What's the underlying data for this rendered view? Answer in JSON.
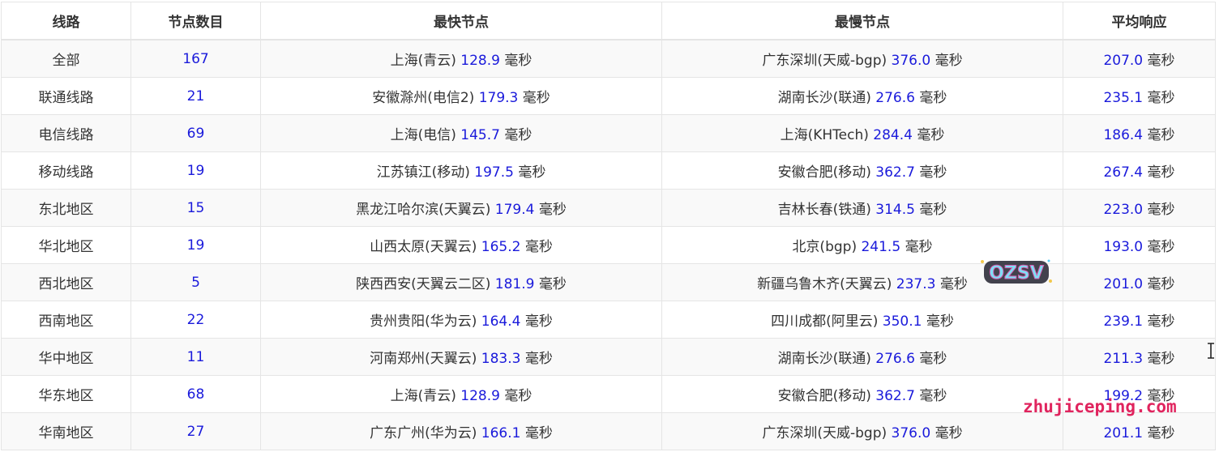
{
  "table": {
    "headers": [
      "线路",
      "节点数目",
      "最快节点",
      "最慢节点",
      "平均响应"
    ],
    "unit": "毫秒",
    "rows": [
      {
        "route": "全部",
        "count": "167",
        "fast_node": "上海(青云)",
        "fast_ms": "128.9",
        "slow_node": "广东深圳(天威-bgp)",
        "slow_ms": "376.0",
        "avg_ms": "207.0"
      },
      {
        "route": "联通线路",
        "count": "21",
        "fast_node": "安徽滁州(电信2)",
        "fast_ms": "179.3",
        "slow_node": "湖南长沙(联通)",
        "slow_ms": "276.6",
        "avg_ms": "235.1"
      },
      {
        "route": "电信线路",
        "count": "69",
        "fast_node": "上海(电信)",
        "fast_ms": "145.7",
        "slow_node": "上海(KHTech)",
        "slow_ms": "284.4",
        "avg_ms": "186.4"
      },
      {
        "route": "移动线路",
        "count": "19",
        "fast_node": "江苏镇江(移动)",
        "fast_ms": "197.5",
        "slow_node": "安徽合肥(移动)",
        "slow_ms": "362.7",
        "avg_ms": "267.4"
      },
      {
        "route": "东北地区",
        "count": "15",
        "fast_node": "黑龙江哈尔滨(天翼云)",
        "fast_ms": "179.4",
        "slow_node": "吉林长春(铁通)",
        "slow_ms": "314.5",
        "avg_ms": "223.0"
      },
      {
        "route": "华北地区",
        "count": "19",
        "fast_node": "山西太原(天翼云)",
        "fast_ms": "165.2",
        "slow_node": "北京(bgp)",
        "slow_ms": "241.5",
        "avg_ms": "193.0"
      },
      {
        "route": "西北地区",
        "count": "5",
        "fast_node": "陕西西安(天翼云二区)",
        "fast_ms": "181.9",
        "slow_node": "新疆乌鲁木齐(天翼云)",
        "slow_ms": "237.3",
        "avg_ms": "201.0"
      },
      {
        "route": "西南地区",
        "count": "22",
        "fast_node": "贵州贵阳(华为云)",
        "fast_ms": "164.4",
        "slow_node": "四川成都(阿里云)",
        "slow_ms": "350.1",
        "avg_ms": "239.1"
      },
      {
        "route": "华中地区",
        "count": "11",
        "fast_node": "河南郑州(天翼云)",
        "fast_ms": "183.3",
        "slow_node": "湖南长沙(联通)",
        "slow_ms": "276.6",
        "avg_ms": "211.3"
      },
      {
        "route": "华东地区",
        "count": "68",
        "fast_node": "上海(青云)",
        "fast_ms": "128.9",
        "slow_node": "安徽合肥(移动)",
        "slow_ms": "362.7",
        "avg_ms": "199.2"
      },
      {
        "route": "华南地区",
        "count": "27",
        "fast_node": "广东广州(华为云)",
        "fast_ms": "166.1",
        "slow_node": "广东深圳(天威-bgp)",
        "slow_ms": "376.0",
        "avg_ms": "201.1"
      }
    ]
  },
  "watermarks": {
    "logo_text": "OZSV",
    "site_text": "zhujiceping.com"
  },
  "colors": {
    "number_blue": "#1a1adb",
    "text": "#333333",
    "watermark_pink": "#e0245e"
  }
}
